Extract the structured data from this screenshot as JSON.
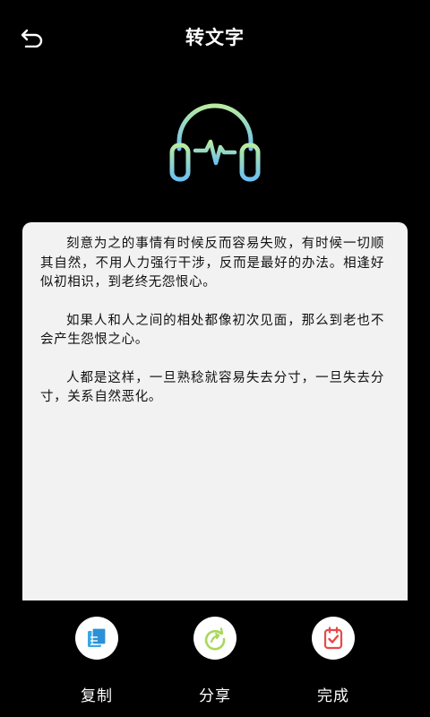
{
  "header": {
    "title": "转文字",
    "back_icon": "undo-arrow-icon"
  },
  "hero": {
    "icon": "headphone-waveform-icon",
    "gradient": [
      "#a8e6a0",
      "#7ec8f0"
    ]
  },
  "card": {
    "paragraphs": [
      "刻意为之的事情有时候反而容易失败，有时候一切顺其自然，不用人力强行干涉，反而是最好的办法。相逢好似初相识，到老终无怨恨心。",
      "如果人和人之间的相处都像初次见面，那么到老也不会产生怨恨之心。",
      "人都是这样，一旦熟稔就容易失去分寸，一旦失去分寸，关系自然恶化。"
    ]
  },
  "actions": [
    {
      "label": "复制",
      "icon": "copy-icon",
      "color": "#35a8e8"
    },
    {
      "label": "分享",
      "icon": "share-icon",
      "color": "#a8d85a"
    },
    {
      "label": "完成",
      "icon": "done-icon",
      "color": "#e84848"
    }
  ],
  "colors": {
    "background": "#000000",
    "card": "#f2f2f2"
  }
}
